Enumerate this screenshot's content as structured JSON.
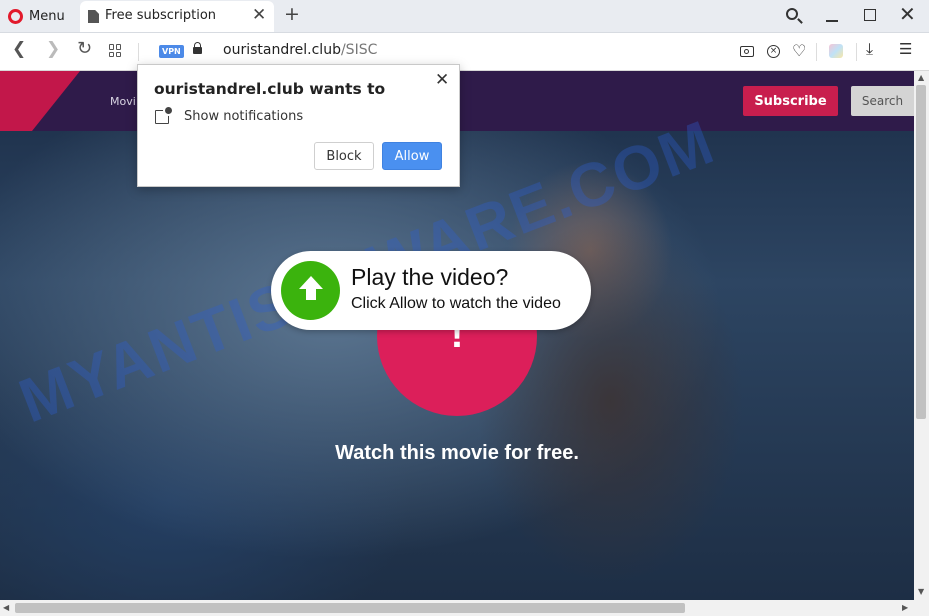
{
  "browser": {
    "menu_label": "Menu",
    "tab_title": "Free subscription",
    "tab_close": "✕",
    "new_tab": "+",
    "vpn_badge": "VPN",
    "url_domain": "ouristandrel.club",
    "url_path": "/SISC",
    "window_close": "✕",
    "download_icon": "⤓",
    "heart_icon": "♡",
    "easy_setup_icon": "☰"
  },
  "notification": {
    "title": "ouristandrel.club wants to",
    "permission": "Show notifications",
    "block_label": "Block",
    "allow_label": "Allow",
    "close": "✕"
  },
  "site": {
    "nav_movies": "Movi",
    "subscribe_label": "Subscribe",
    "search_label": "Search",
    "play_title": "Play the video?",
    "play_subtitle": "Click Allow to watch the video",
    "exclamation": "!",
    "watch_text": "Watch this movie for free.",
    "watermark": "MYANTISPYWARE.COM"
  },
  "colors": {
    "accent_red": "#dc1f5a",
    "header_purple": "#2f1b4a",
    "allow_blue": "#4a90f0",
    "play_green": "#3bb30d"
  }
}
